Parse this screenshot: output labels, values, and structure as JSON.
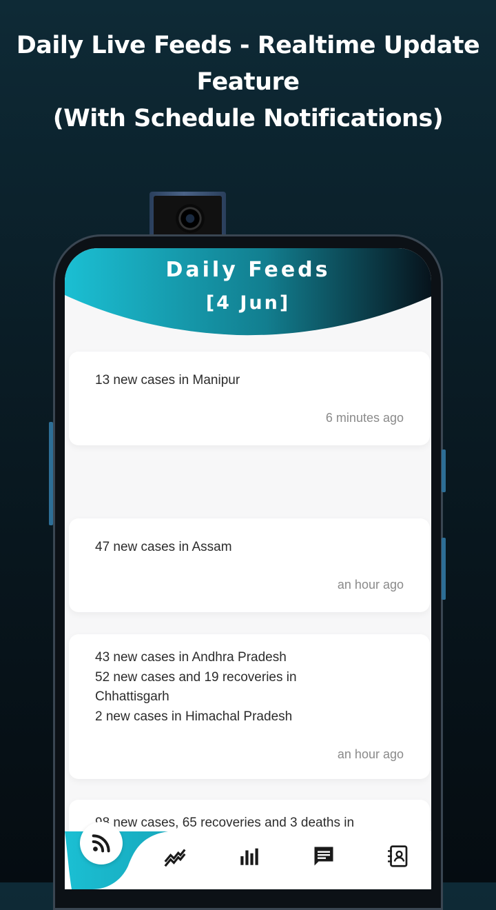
{
  "promo": {
    "line1": "Daily Live Feeds - Realtime Update",
    "line2": "Feature",
    "line3": "(With Schedule Notifications)"
  },
  "screen": {
    "title": "Daily Feeds",
    "date": "[4 Jun]"
  },
  "feeds": [
    {
      "lines": [
        "13 new cases in Manipur"
      ],
      "time": "6 minutes ago"
    },
    {
      "lines": [
        "47 new cases in Assam"
      ],
      "time": "an hour ago"
    },
    {
      "lines": [
        "43 new cases in Andhra Pradesh",
        "52 new cases and 19 recoveries in",
        "Chhattisgarh",
        "2 new cases in Himachal Pradesh"
      ],
      "time": "an hour ago"
    },
    {
      "lines": [
        "98 new cases, 65 recoveries and 3 deaths in"
      ],
      "time": ""
    }
  ],
  "nav": {
    "items": [
      "rss-icon",
      "trend-icon",
      "bar-chart-icon",
      "chat-icon",
      "contacts-icon"
    ],
    "active": "rss-icon"
  },
  "colors": {
    "accent": "#1bbfd3",
    "accent_dark": "#0a2a38",
    "icon": "#1a1a1a"
  }
}
